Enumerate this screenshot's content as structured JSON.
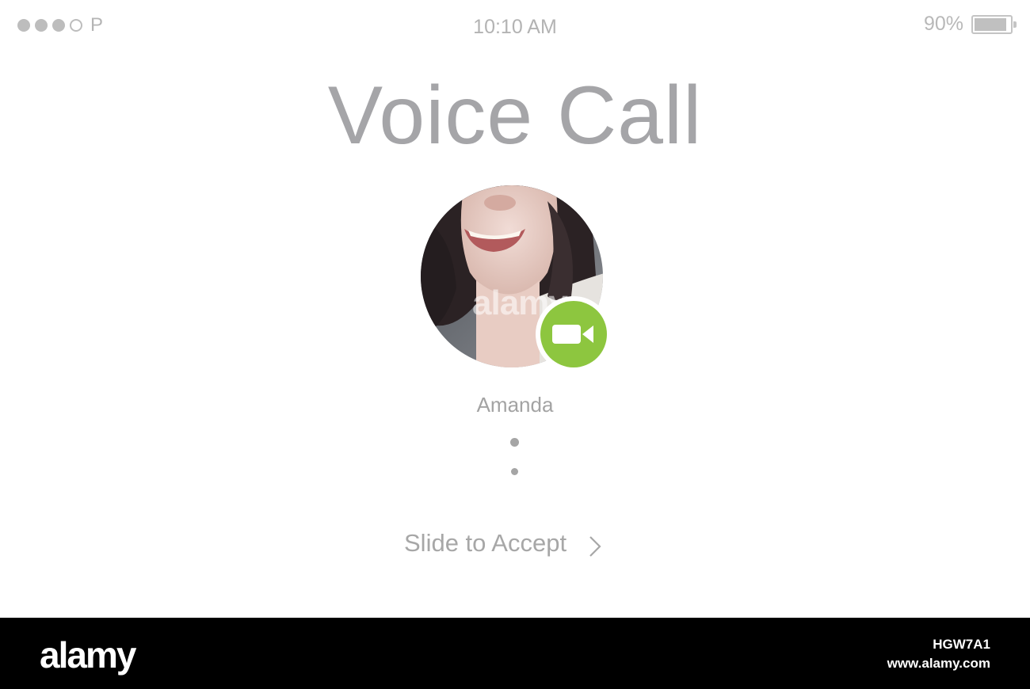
{
  "status_bar": {
    "carrier": "P",
    "signal_bars_filled": 3,
    "signal_bars_total": 4,
    "time": "10:10 AM",
    "battery_percent": "90%",
    "battery_level": 0.9
  },
  "call": {
    "title": "Voice Call",
    "caller_name": "Amanda",
    "video_icon": "video-camera-icon",
    "accent_color": "#8dc63f",
    "slide_label": "Slide to Accept",
    "slide_icon": "chevron-right-icon"
  },
  "watermark": {
    "center_text": "alamy",
    "footer_logo": "alamy",
    "image_id": "HGW7A1",
    "site": "www.alamy.com"
  }
}
